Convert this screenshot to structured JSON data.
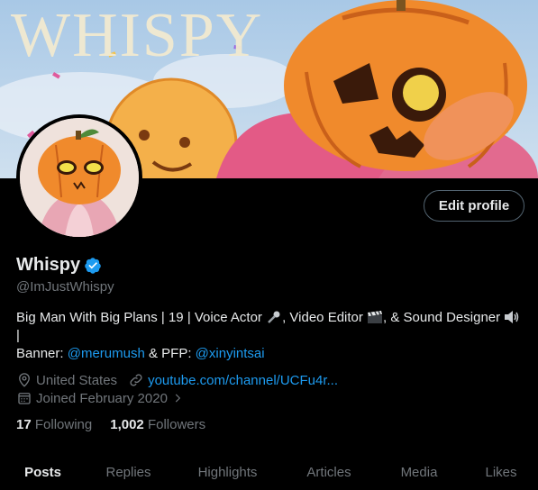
{
  "banner": {
    "text": "WHISPY"
  },
  "profile": {
    "edit_label": "Edit profile",
    "name": "Whispy",
    "handle": "@ImJustWhispy",
    "bio_line1": "Big Man With Big Plans | 19 | Voice Actor ",
    "bio_part2": ", Video Editor ",
    "bio_part3": ", & Sound Designer ",
    "bio_line2": "|",
    "banner_label": "Banner: ",
    "banner_link": "@merumush",
    "pfp_label": " & PFP: ",
    "pfp_link": "@xinyintsai",
    "location": "United States",
    "website": "youtube.com/channel/UCFu4r...",
    "joined": "Joined February 2020",
    "following_count": "17",
    "following_label": "Following",
    "followers_count": "1,002",
    "followers_label": "Followers"
  },
  "tabs": [
    "Posts",
    "Replies",
    "Highlights",
    "Articles",
    "Media",
    "Likes"
  ],
  "colors": {
    "accent": "#1d9bf0",
    "muted": "#71767b",
    "text": "#e7e9ea",
    "background": "#000000"
  }
}
